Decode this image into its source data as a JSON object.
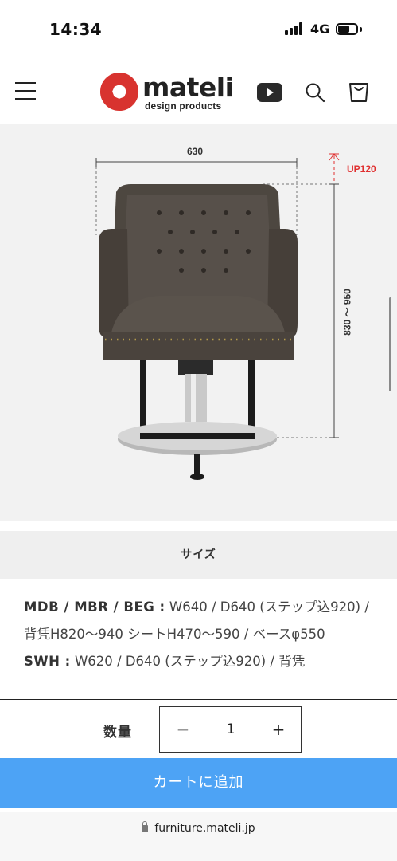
{
  "status_bar": {
    "time": "14:34",
    "network": "4G"
  },
  "header": {
    "brand_name": "mateli",
    "brand_tagline": "design products",
    "icons": [
      "menu-icon",
      "youtube-icon",
      "search-icon",
      "cart-icon"
    ]
  },
  "product_image": {
    "width_dim": "630",
    "height_dim": "830 ～ 950",
    "up_dim": "UP120"
  },
  "tabs": {
    "size_label": "サイズ"
  },
  "spec": {
    "line1_label": "MDB / MBR / BEG :",
    "line1_text": " W640 / D640 (ステップ込920) / 背凭H820～940 シートH470～590 / ベースφ550",
    "line2_label": "SWH :",
    "line2_text": " W620 / D640 (ステップ込920) / 背凭"
  },
  "purchase": {
    "qty_label": "数量",
    "minus": "−",
    "qty_value": "1",
    "plus": "+",
    "cart_button": "カートに追加"
  },
  "browser": {
    "url": "furniture.mateli.jp"
  },
  "colors": {
    "accent_blue": "#4da3f5",
    "dimension_red": "#e03030",
    "logo_red": "#d8332f"
  }
}
